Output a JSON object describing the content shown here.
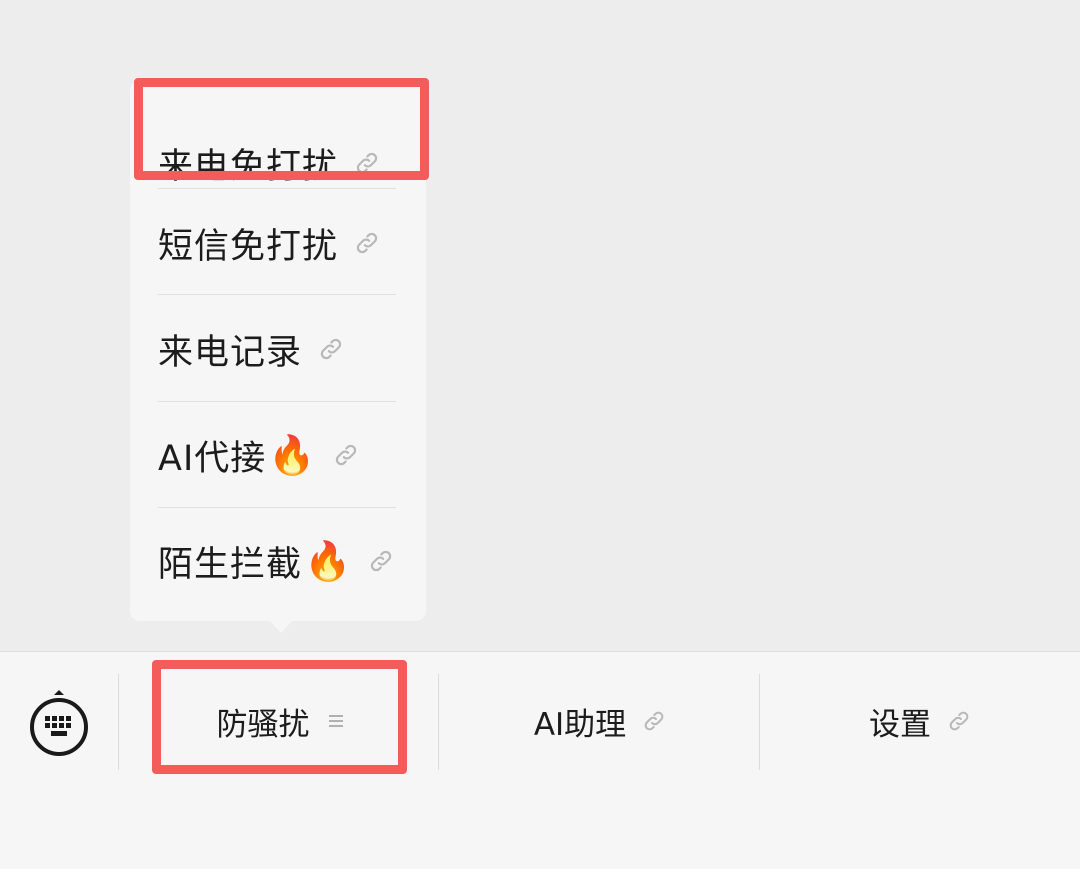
{
  "popup_menu": {
    "items": [
      {
        "label": "来电免打扰",
        "hot": ""
      },
      {
        "label": "短信免打扰",
        "hot": ""
      },
      {
        "label": "来电记录",
        "hot": ""
      },
      {
        "label": "AI代接",
        "hot": "🔥"
      },
      {
        "label": "陌生拦截",
        "hot": "🔥"
      }
    ]
  },
  "bottom_menu": {
    "keyboard_icon": "keyboard-icon",
    "items": [
      {
        "label": "防骚扰",
        "icon": "menu-lines-icon"
      },
      {
        "label": "AI助理",
        "icon": "link-icon"
      },
      {
        "label": "设置",
        "icon": "link-icon"
      }
    ]
  },
  "colors": {
    "highlight": "#f45b5b",
    "background": "#ededed",
    "menu_background": "#f6f6f6"
  }
}
